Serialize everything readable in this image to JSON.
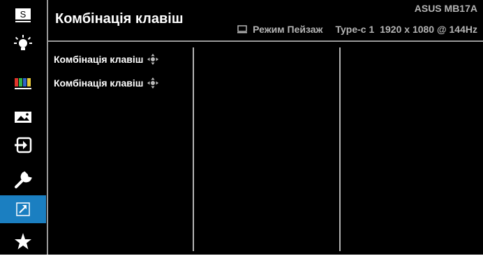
{
  "header": {
    "title": "Комбінація клавіш",
    "model": "ASUS MB17A",
    "mode": "Режим Пейзаж",
    "input": "Type-c 1",
    "resolution": "1920 x 1080 @ 144Hz"
  },
  "menu": {
    "items": [
      {
        "label": "Комбінація клавіш"
      },
      {
        "label": "Комбінація клавіш"
      }
    ]
  },
  "sidebar": {
    "items": [
      {
        "icon": "splendid-s-icon",
        "label": "S"
      },
      {
        "icon": "blue-light-icon"
      },
      {
        "icon": "color-bars-icon"
      },
      {
        "icon": "image-icon"
      },
      {
        "icon": "input-select-icon"
      },
      {
        "icon": "wrench-icon"
      },
      {
        "icon": "shortcut-arrow-icon",
        "active": true
      },
      {
        "icon": "star-icon"
      }
    ]
  },
  "colors": {
    "background": "#000000",
    "active": "#1b7fc1",
    "text": "#ffffff",
    "secondary_text": "#b4b4b4"
  }
}
